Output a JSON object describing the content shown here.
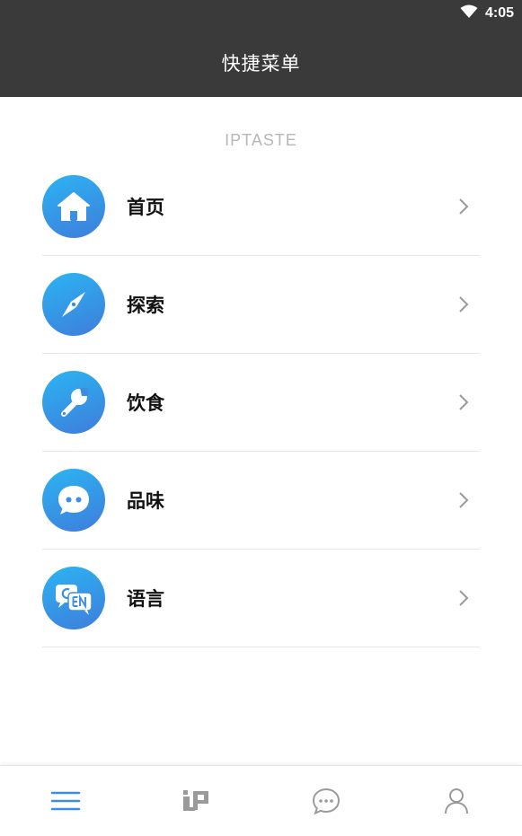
{
  "status_bar": {
    "time": "4:05",
    "wifi_icon": "wifi-icon"
  },
  "app_bar": {
    "title": "快捷菜单"
  },
  "section": {
    "title": "IPTASTE"
  },
  "menu": {
    "items": [
      {
        "label": "首页",
        "icon": "home-icon"
      },
      {
        "label": "探索",
        "icon": "compass-icon"
      },
      {
        "label": "饮食",
        "icon": "wrench-icon"
      },
      {
        "label": "品味",
        "icon": "chat-face-icon"
      },
      {
        "label": "语言",
        "icon": "language-cn-en-icon"
      }
    ]
  },
  "bottom_nav": {
    "items": [
      {
        "icon": "menu-icon",
        "active": true
      },
      {
        "icon": "ip-logo-icon",
        "active": false
      },
      {
        "icon": "message-icon",
        "active": false
      },
      {
        "icon": "profile-icon",
        "active": false
      }
    ]
  },
  "colors": {
    "header_bg": "#3a3a3a",
    "accent": "#3b8ee6",
    "icon_gradient_start": "#2cb4f2",
    "icon_gradient_end": "#3e7ddb",
    "inactive_icon": "#9a9a9a"
  }
}
